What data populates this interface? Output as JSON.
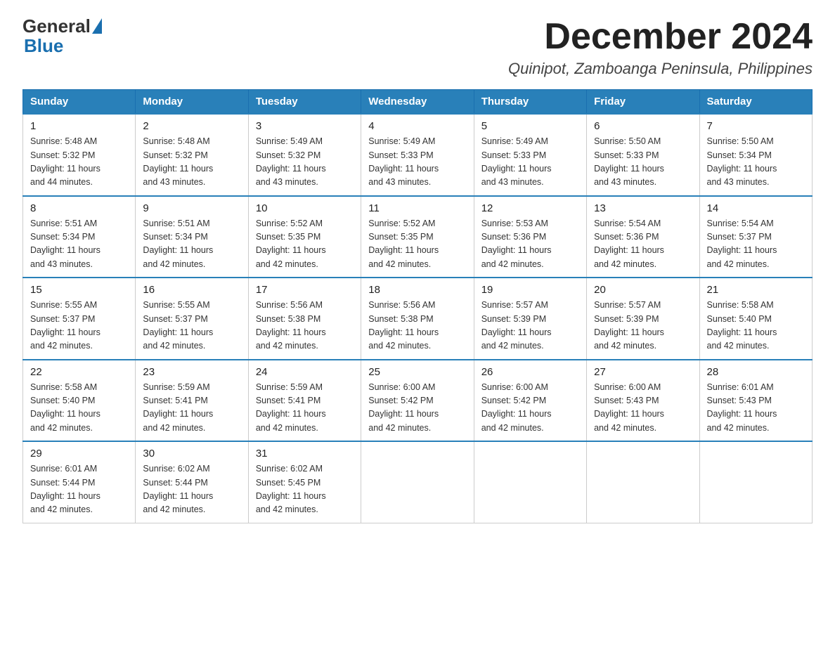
{
  "logo": {
    "general": "General",
    "blue": "Blue"
  },
  "title": "December 2024",
  "location": "Quinipot, Zamboanga Peninsula, Philippines",
  "days_of_week": [
    "Sunday",
    "Monday",
    "Tuesday",
    "Wednesday",
    "Thursday",
    "Friday",
    "Saturday"
  ],
  "weeks": [
    [
      {
        "day": "1",
        "sunrise": "5:48 AM",
        "sunset": "5:32 PM",
        "daylight": "11 hours and 44 minutes."
      },
      {
        "day": "2",
        "sunrise": "5:48 AM",
        "sunset": "5:32 PM",
        "daylight": "11 hours and 43 minutes."
      },
      {
        "day": "3",
        "sunrise": "5:49 AM",
        "sunset": "5:32 PM",
        "daylight": "11 hours and 43 minutes."
      },
      {
        "day": "4",
        "sunrise": "5:49 AM",
        "sunset": "5:33 PM",
        "daylight": "11 hours and 43 minutes."
      },
      {
        "day": "5",
        "sunrise": "5:49 AM",
        "sunset": "5:33 PM",
        "daylight": "11 hours and 43 minutes."
      },
      {
        "day": "6",
        "sunrise": "5:50 AM",
        "sunset": "5:33 PM",
        "daylight": "11 hours and 43 minutes."
      },
      {
        "day": "7",
        "sunrise": "5:50 AM",
        "sunset": "5:34 PM",
        "daylight": "11 hours and 43 minutes."
      }
    ],
    [
      {
        "day": "8",
        "sunrise": "5:51 AM",
        "sunset": "5:34 PM",
        "daylight": "11 hours and 43 minutes."
      },
      {
        "day": "9",
        "sunrise": "5:51 AM",
        "sunset": "5:34 PM",
        "daylight": "11 hours and 42 minutes."
      },
      {
        "day": "10",
        "sunrise": "5:52 AM",
        "sunset": "5:35 PM",
        "daylight": "11 hours and 42 minutes."
      },
      {
        "day": "11",
        "sunrise": "5:52 AM",
        "sunset": "5:35 PM",
        "daylight": "11 hours and 42 minutes."
      },
      {
        "day": "12",
        "sunrise": "5:53 AM",
        "sunset": "5:36 PM",
        "daylight": "11 hours and 42 minutes."
      },
      {
        "day": "13",
        "sunrise": "5:54 AM",
        "sunset": "5:36 PM",
        "daylight": "11 hours and 42 minutes."
      },
      {
        "day": "14",
        "sunrise": "5:54 AM",
        "sunset": "5:37 PM",
        "daylight": "11 hours and 42 minutes."
      }
    ],
    [
      {
        "day": "15",
        "sunrise": "5:55 AM",
        "sunset": "5:37 PM",
        "daylight": "11 hours and 42 minutes."
      },
      {
        "day": "16",
        "sunrise": "5:55 AM",
        "sunset": "5:37 PM",
        "daylight": "11 hours and 42 minutes."
      },
      {
        "day": "17",
        "sunrise": "5:56 AM",
        "sunset": "5:38 PM",
        "daylight": "11 hours and 42 minutes."
      },
      {
        "day": "18",
        "sunrise": "5:56 AM",
        "sunset": "5:38 PM",
        "daylight": "11 hours and 42 minutes."
      },
      {
        "day": "19",
        "sunrise": "5:57 AM",
        "sunset": "5:39 PM",
        "daylight": "11 hours and 42 minutes."
      },
      {
        "day": "20",
        "sunrise": "5:57 AM",
        "sunset": "5:39 PM",
        "daylight": "11 hours and 42 minutes."
      },
      {
        "day": "21",
        "sunrise": "5:58 AM",
        "sunset": "5:40 PM",
        "daylight": "11 hours and 42 minutes."
      }
    ],
    [
      {
        "day": "22",
        "sunrise": "5:58 AM",
        "sunset": "5:40 PM",
        "daylight": "11 hours and 42 minutes."
      },
      {
        "day": "23",
        "sunrise": "5:59 AM",
        "sunset": "5:41 PM",
        "daylight": "11 hours and 42 minutes."
      },
      {
        "day": "24",
        "sunrise": "5:59 AM",
        "sunset": "5:41 PM",
        "daylight": "11 hours and 42 minutes."
      },
      {
        "day": "25",
        "sunrise": "6:00 AM",
        "sunset": "5:42 PM",
        "daylight": "11 hours and 42 minutes."
      },
      {
        "day": "26",
        "sunrise": "6:00 AM",
        "sunset": "5:42 PM",
        "daylight": "11 hours and 42 minutes."
      },
      {
        "day": "27",
        "sunrise": "6:00 AM",
        "sunset": "5:43 PM",
        "daylight": "11 hours and 42 minutes."
      },
      {
        "day": "28",
        "sunrise": "6:01 AM",
        "sunset": "5:43 PM",
        "daylight": "11 hours and 42 minutes."
      }
    ],
    [
      {
        "day": "29",
        "sunrise": "6:01 AM",
        "sunset": "5:44 PM",
        "daylight": "11 hours and 42 minutes."
      },
      {
        "day": "30",
        "sunrise": "6:02 AM",
        "sunset": "5:44 PM",
        "daylight": "11 hours and 42 minutes."
      },
      {
        "day": "31",
        "sunrise": "6:02 AM",
        "sunset": "5:45 PM",
        "daylight": "11 hours and 42 minutes."
      },
      null,
      null,
      null,
      null
    ]
  ],
  "labels": {
    "sunrise": "Sunrise:",
    "sunset": "Sunset:",
    "daylight": "Daylight:"
  }
}
